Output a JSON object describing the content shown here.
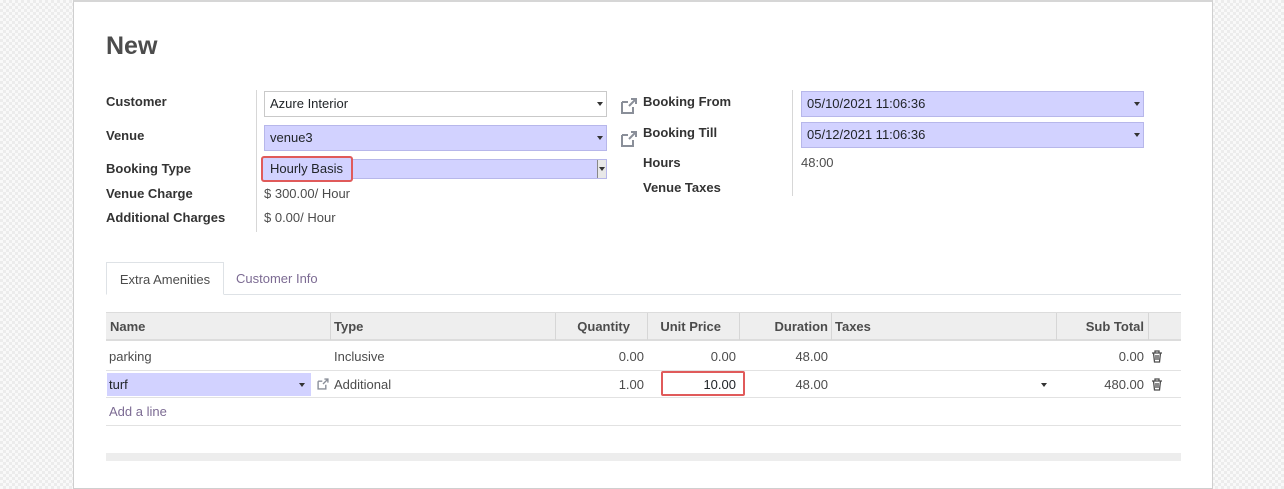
{
  "form": {
    "title": "New",
    "left_fields": {
      "customer": {
        "label": "Customer",
        "value": "Azure Interior"
      },
      "venue": {
        "label": "Venue",
        "value": "venue3"
      },
      "booking_type": {
        "label": "Booking Type",
        "value": "Hourly Basis"
      },
      "venue_charge": {
        "label": "Venue Charge",
        "value": "$ 300.00/ Hour"
      },
      "additional_charges": {
        "label": "Additional Charges",
        "value": "$ 0.00/ Hour"
      }
    },
    "right_fields": {
      "booking_from": {
        "label": "Booking From",
        "value": "05/10/2021 11:06:36"
      },
      "booking_till": {
        "label": "Booking Till",
        "value": "05/12/2021 11:06:36"
      },
      "hours": {
        "label": "Hours",
        "value": "48:00"
      },
      "venue_taxes": {
        "label": "Venue Taxes",
        "value": ""
      }
    }
  },
  "tabs": [
    {
      "label": "Extra Amenities",
      "active": true
    },
    {
      "label": "Customer Info",
      "active": false
    }
  ],
  "table": {
    "columns": [
      "Name",
      "Type",
      "Quantity",
      "Unit Price",
      "Duration",
      "Taxes",
      "Sub Total"
    ],
    "rows": [
      {
        "name": "parking",
        "type": "Inclusive",
        "quantity": "0.00",
        "unit_price": "0.00",
        "duration": "48.00",
        "taxes": "",
        "subtotal": "0.00"
      },
      {
        "name": "turf",
        "type": "Additional",
        "quantity": "1.00",
        "unit_price": "10.00",
        "duration": "48.00",
        "taxes": "",
        "subtotal": "480.00"
      }
    ],
    "add_line": "Add a line"
  },
  "colors": {
    "required_field_bg": "#d2d2ff",
    "accent_link": "#7c6b93",
    "highlight_border": "#e05a5a"
  },
  "icons": [
    "external-link-icon",
    "dropdown-caret-icon",
    "trash-icon"
  ]
}
